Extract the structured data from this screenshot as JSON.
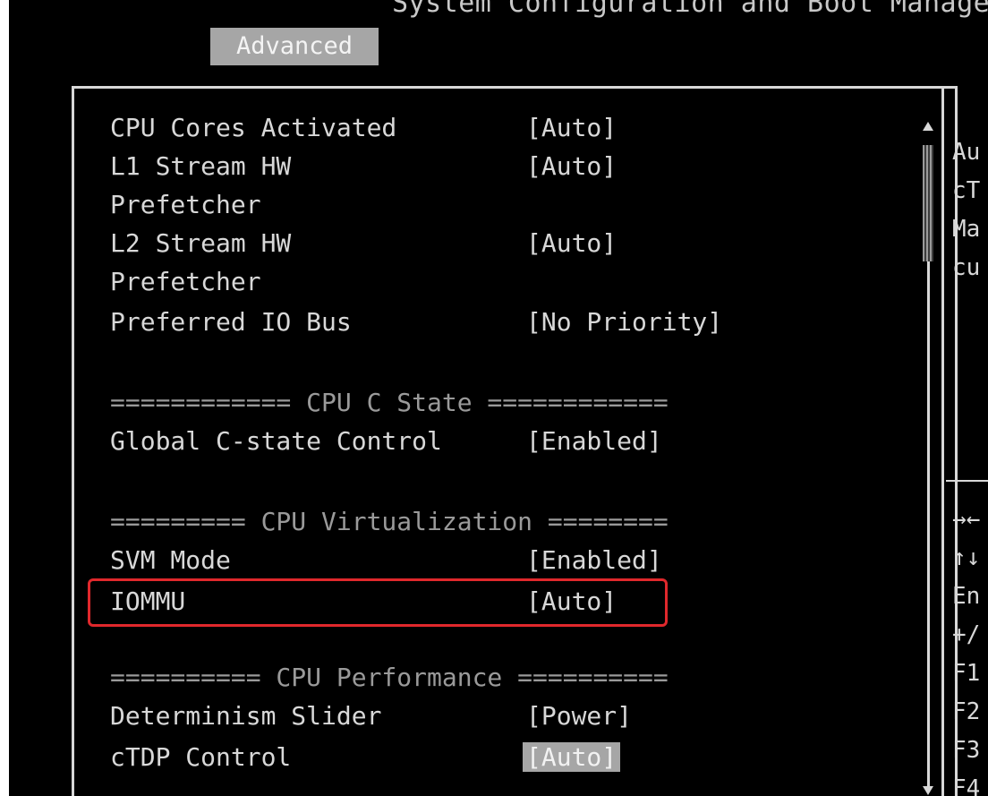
{
  "header": {
    "title": "System Configuration and Boot Manage",
    "active_tab": "Advanced"
  },
  "settings": [
    {
      "label": "CPU Cores Activated",
      "value": "[Auto]"
    },
    {
      "label": "L1 Stream HW",
      "label2": "Prefetcher",
      "value": "[Auto]"
    },
    {
      "label": "L2 Stream HW",
      "label2": "Prefetcher",
      "value": "[Auto]"
    },
    {
      "label": "Preferred IO Bus",
      "value": "[No Priority]"
    },
    {
      "label": "Global C-state Control",
      "value": "[Enabled]"
    },
    {
      "label": "SVM Mode",
      "value": "[Enabled]"
    },
    {
      "label": "IOMMU",
      "value": "[Auto]"
    },
    {
      "label": "Determinism Slider",
      "value": "[Power]"
    },
    {
      "label": "cTDP Control",
      "value": "[Auto]"
    }
  ],
  "sections": {
    "cpu_c_state": "============ CPU C State ============",
    "cpu_virtualization": "========= CPU Virtualization ========",
    "cpu_performance": "========== CPU Performance =========="
  },
  "help_panel": {
    "lines": [
      "Au",
      "cT",
      "Ma",
      "cu"
    ],
    "keys": [
      "→←",
      "↑↓",
      "En",
      "+/",
      "F1",
      "F2",
      "F3",
      "F4"
    ]
  },
  "colors": {
    "background": "#000000",
    "text": "#d8d8d8",
    "tab_highlight": "#a6a6a6",
    "annotation_red": "#e0282c"
  }
}
